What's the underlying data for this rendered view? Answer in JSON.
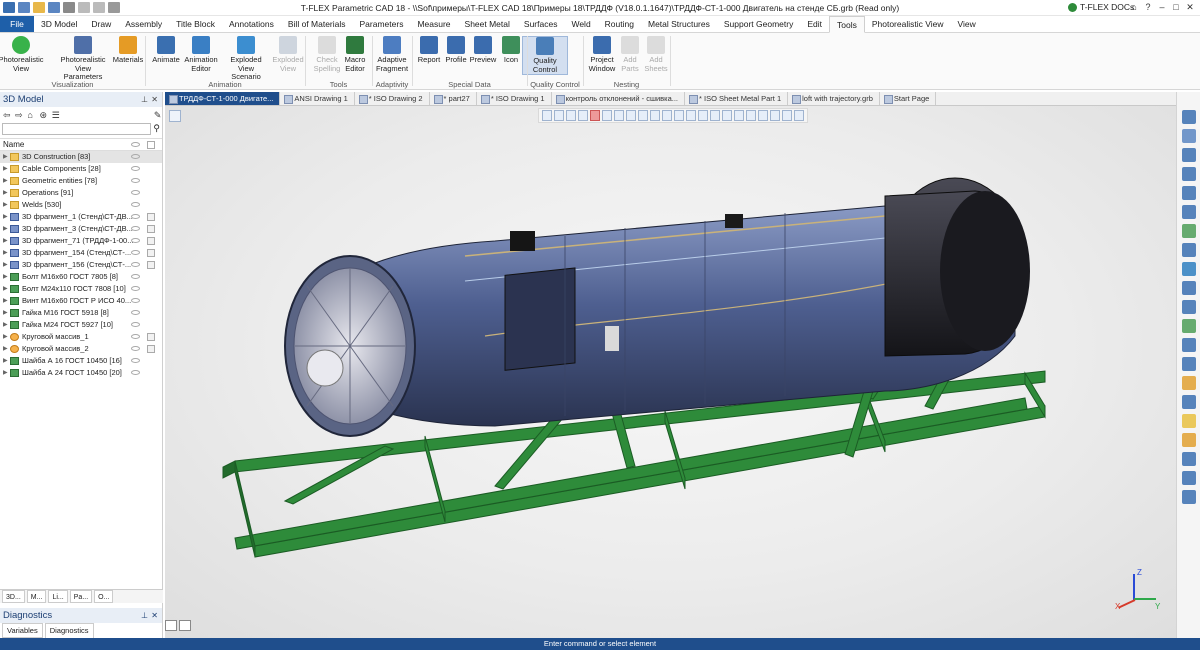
{
  "titlebar": {
    "title": "T-FLEX Parametric CAD 18 - \\\\Sof\\примеры\\T-FLEX CAD 18\\Примеры 18\\ТРДДФ (V18.0.1.1647)\\ТРДДФ-СТ-1-000 Двигатель на стенде СБ.grb (Read only)",
    "docs_label": "T-FLEX DOCs"
  },
  "menu": {
    "tabs": [
      "File",
      "3D Model",
      "Draw",
      "Assembly",
      "Title Block",
      "Annotations",
      "Bill of Materials",
      "Parameters",
      "Measure",
      "Sheet Metal",
      "Surfaces",
      "Weld",
      "Routing",
      "Metal Structures",
      "Support Geometry",
      "Edit",
      "Tools",
      "Photorealistic View",
      "View"
    ],
    "active": "Tools"
  },
  "ribbon": {
    "buttons": [
      {
        "label1": "Photorealistic",
        "label2": "View",
        "color": "#38b24a",
        "disabled": false
      },
      {
        "label1": "Photorealistic",
        "label2": "View Parameters",
        "color": "#4f6fa8",
        "disabled": false
      },
      {
        "label1": "Materials",
        "label2": "",
        "color": "#e59b25",
        "disabled": false
      },
      {
        "label1": "Animate",
        "label2": "",
        "color": "#3a6fb0",
        "disabled": false
      },
      {
        "label1": "Animation",
        "label2": "Editor",
        "color": "#3a7fc4",
        "disabled": false
      },
      {
        "label1": "Exploded View",
        "label2": "Scenario",
        "color": "#3c8ed0",
        "disabled": false
      },
      {
        "label1": "Exploded",
        "label2": "View",
        "color": "#9aa9bd",
        "disabled": true
      },
      {
        "label1": "Check",
        "label2": "Spelling",
        "color": "#b8b8b8",
        "disabled": true
      },
      {
        "label1": "Macro",
        "label2": "Editor",
        "color": "#2f7a3e",
        "disabled": false
      },
      {
        "label1": "Adaptive",
        "label2": "Fragment",
        "color": "#4d7dc1",
        "disabled": false
      },
      {
        "label1": "Report",
        "label2": "",
        "color": "#3b6cae",
        "disabled": false
      },
      {
        "label1": "Profile",
        "label2": "",
        "color": "#3b6cae",
        "disabled": false
      },
      {
        "label1": "Preview",
        "label2": "",
        "color": "#3b6cae",
        "disabled": false
      },
      {
        "label1": "Icon",
        "label2": "",
        "color": "#3e8f5b",
        "disabled": false
      },
      {
        "label1": "Quality",
        "label2": "Control",
        "color": "#4a7eb8",
        "disabled": false
      },
      {
        "label1": "Project",
        "label2": "Window",
        "color": "#3b6cae",
        "disabled": false
      },
      {
        "label1": "Add",
        "label2": "Parts",
        "color": "#b8b8b8",
        "disabled": true
      },
      {
        "label1": "Add",
        "label2": "Sheets",
        "color": "#b8b8b8",
        "disabled": true
      }
    ],
    "groups": [
      "Visualization",
      "Animation",
      "Tools",
      "Adaptivity",
      "Special Data",
      "Quality Control",
      "Nesting"
    ]
  },
  "left_panel": {
    "title": "3D Model",
    "column_name": "Name",
    "tree": [
      {
        "label": "3D Construction [83]",
        "icon": "fold",
        "selected": true
      },
      {
        "label": "Cable Components [28]",
        "icon": "fold"
      },
      {
        "label": "Geometric entities [78]",
        "icon": "fold"
      },
      {
        "label": "Operations [91]",
        "icon": "fold"
      },
      {
        "label": "Welds [530]",
        "icon": "fold"
      },
      {
        "label": "3D фрагмент_1 (Стенд\\СТ-ДВ...",
        "icon": "frag"
      },
      {
        "label": "3D фрагмент_3 (Стенд\\СТ-ДВ...",
        "icon": "frag"
      },
      {
        "label": "3D фрагмент_71 (ТРДДФ-1-00...",
        "icon": "frag"
      },
      {
        "label": "3D фрагмент_154 (Стенд\\СТ-...",
        "icon": "frag"
      },
      {
        "label": "3D фрагмент_156 (Стенд\\СТ-...",
        "icon": "frag"
      },
      {
        "label": "Болт М16х60 ГОСТ 7805 [8]",
        "icon": "bolt"
      },
      {
        "label": "Болт М24х110 ГОСТ 7808 [10]",
        "icon": "bolt"
      },
      {
        "label": "Винт М16х60 ГОСТ Р ИСО 40...",
        "icon": "bolt"
      },
      {
        "label": "Гайка М16 ГОСТ 5918 [8]",
        "icon": "bolt"
      },
      {
        "label": "Гайка М24 ГОСТ 5927 [10]",
        "icon": "bolt"
      },
      {
        "label": "Круговой массив_1",
        "icon": "mass"
      },
      {
        "label": "Круговой массив_2",
        "icon": "mass"
      },
      {
        "label": "Шайба А 16 ГОСТ 10450 [16]",
        "icon": "bolt"
      },
      {
        "label": "Шайба А 24 ГОСТ 10450 [20]",
        "icon": "bolt"
      }
    ],
    "bottom_tabs": [
      "3D...",
      "M...",
      "Li...",
      "Pa...",
      "O..."
    ]
  },
  "diagnostics": {
    "title": "Diagnostics",
    "tabs": [
      "Variables",
      "Diagnostics"
    ]
  },
  "doc_tabs": [
    "ТРДДФ-СТ-1-000 Двигате...",
    "ANSI Drawing 1",
    "* ISO Drawing 2",
    "* part27",
    "* ISO Drawing 1",
    "контроль отклонений - сшивка...",
    "* ISO Sheet Metal Part 1",
    "loft with trajectory.grb",
    "Start Page"
  ],
  "axis": {
    "x": "X",
    "y": "Y",
    "z": "Z"
  },
  "status": "Enter command or select element",
  "colors": {
    "accent": "#1f4e8c",
    "frame": "#2e8b3a",
    "engine": "#4c5f8a"
  }
}
